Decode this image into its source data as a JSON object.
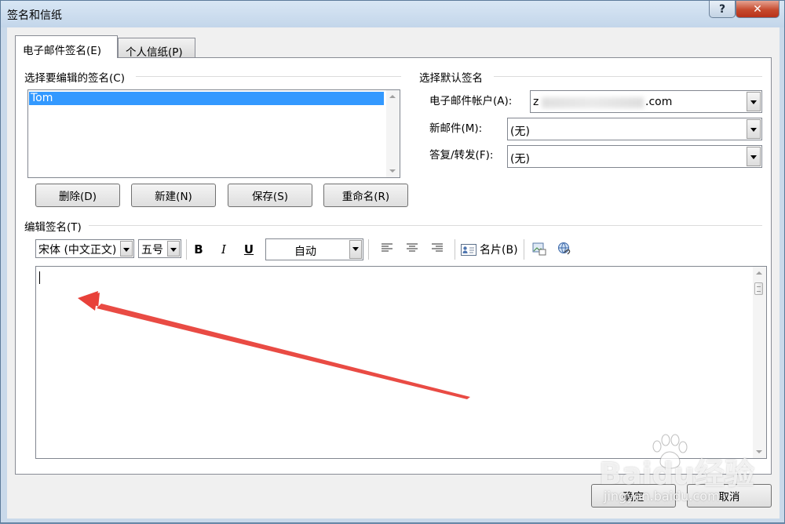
{
  "window": {
    "title": "签名和信纸",
    "help_label": "?",
    "close_label": "✕"
  },
  "tabs": [
    {
      "label": "电子邮件签名(E)"
    },
    {
      "label": "个人信纸(P)"
    }
  ],
  "signatures": {
    "section_label": "选择要编辑的签名(C)",
    "items": [
      "Tom"
    ],
    "delete_label": "删除(D)",
    "new_label": "新建(N)",
    "save_label": "保存(S)",
    "rename_label": "重命名(R)"
  },
  "defaults": {
    "section_label": "选择默认签名",
    "account_label": "电子邮件帐户(A):",
    "account_prefix": "z",
    "account_suffix": ".com",
    "new_msg_label": "新邮件(M):",
    "new_msg_value": "(无)",
    "reply_label": "答复/转发(F):",
    "reply_value": "(无)"
  },
  "editor": {
    "section_label": "编辑签名(T)",
    "font": "宋体 (中文正文)",
    "size": "五号",
    "bold": "B",
    "italic": "I",
    "underline": "U",
    "color": "自动",
    "business_card_label": "名片(B)",
    "content": ""
  },
  "footer": {
    "ok_label": "确定",
    "cancel_label": "取消"
  },
  "watermark": {
    "text": "Baidu经验",
    "sub": "jingyan.baidu.com"
  },
  "icons": [
    "help-icon",
    "close-icon",
    "align-left-icon",
    "align-center-icon",
    "align-right-icon",
    "business-card-icon",
    "insert-picture-icon",
    "hyperlink-icon"
  ],
  "colors": {
    "selection": "#3399ff",
    "title_bar": "#c9d9ea",
    "close_button": "#c64a2e",
    "annotation_arrow": "#e8413a"
  }
}
